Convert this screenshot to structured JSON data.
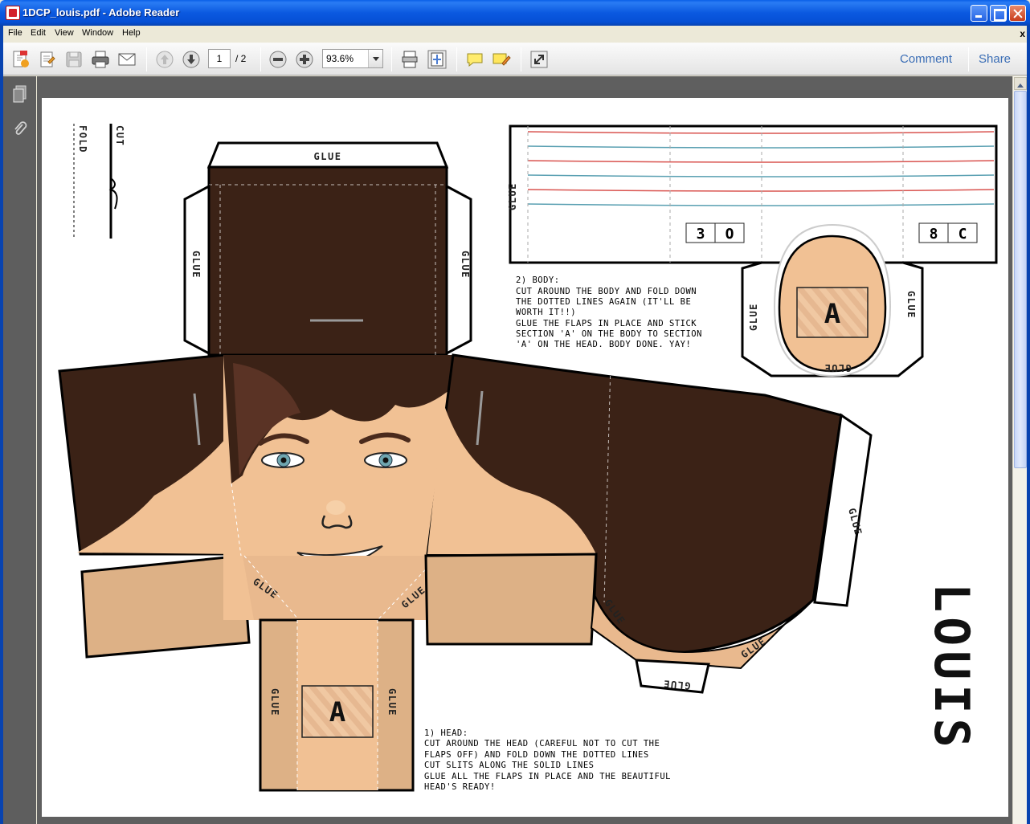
{
  "window": {
    "title": "1DCP_louis.pdf - Adobe Reader"
  },
  "menu": {
    "items": [
      "File",
      "Edit",
      "View",
      "Window",
      "Help"
    ],
    "close_doc": "x"
  },
  "toolbar": {
    "page_current": "1",
    "page_total": "/ 2",
    "zoom": "93.6%",
    "comment_label": "Comment",
    "share_label": "Share"
  },
  "document": {
    "cut_label": "CUT",
    "fold_label": "FOLD",
    "glue_label": "GLUE",
    "section_label": "A",
    "name_label": "LOUIS",
    "box_labels": [
      "3",
      "O",
      "8",
      "C"
    ],
    "body_instructions": [
      "2) BODY:",
      "CUT AROUND THE BODY AND FOLD DOWN",
      "THE DOTTED LINES AGAIN (IT'LL BE",
      "WORTH IT!!)",
      "GLUE THE FLAPS IN PLACE AND STICK",
      "SECTION 'A' ON THE BODY TO SECTION",
      "'A' ON THE HEAD. BODY DONE. YAY!"
    ],
    "head_instructions": [
      "1) HEAD:",
      "CUT AROUND THE HEAD (CAREFUL NOT TO CUT THE",
      "FLAPS OFF) AND FOLD DOWN THE DOTTED LINES",
      "CUT SLITS ALONG THE SOLID LINES",
      "GLUE ALL THE FLAPS IN PLACE AND THE BEAUTIFUL",
      "HEAD'S READY!"
    ]
  },
  "colors": {
    "hair": "#3b2216",
    "skin": "#f1c194",
    "skin_shadow": "#ddb186",
    "titlebar": "#0a5fe8",
    "doc_bg": "#5f5f5f"
  }
}
